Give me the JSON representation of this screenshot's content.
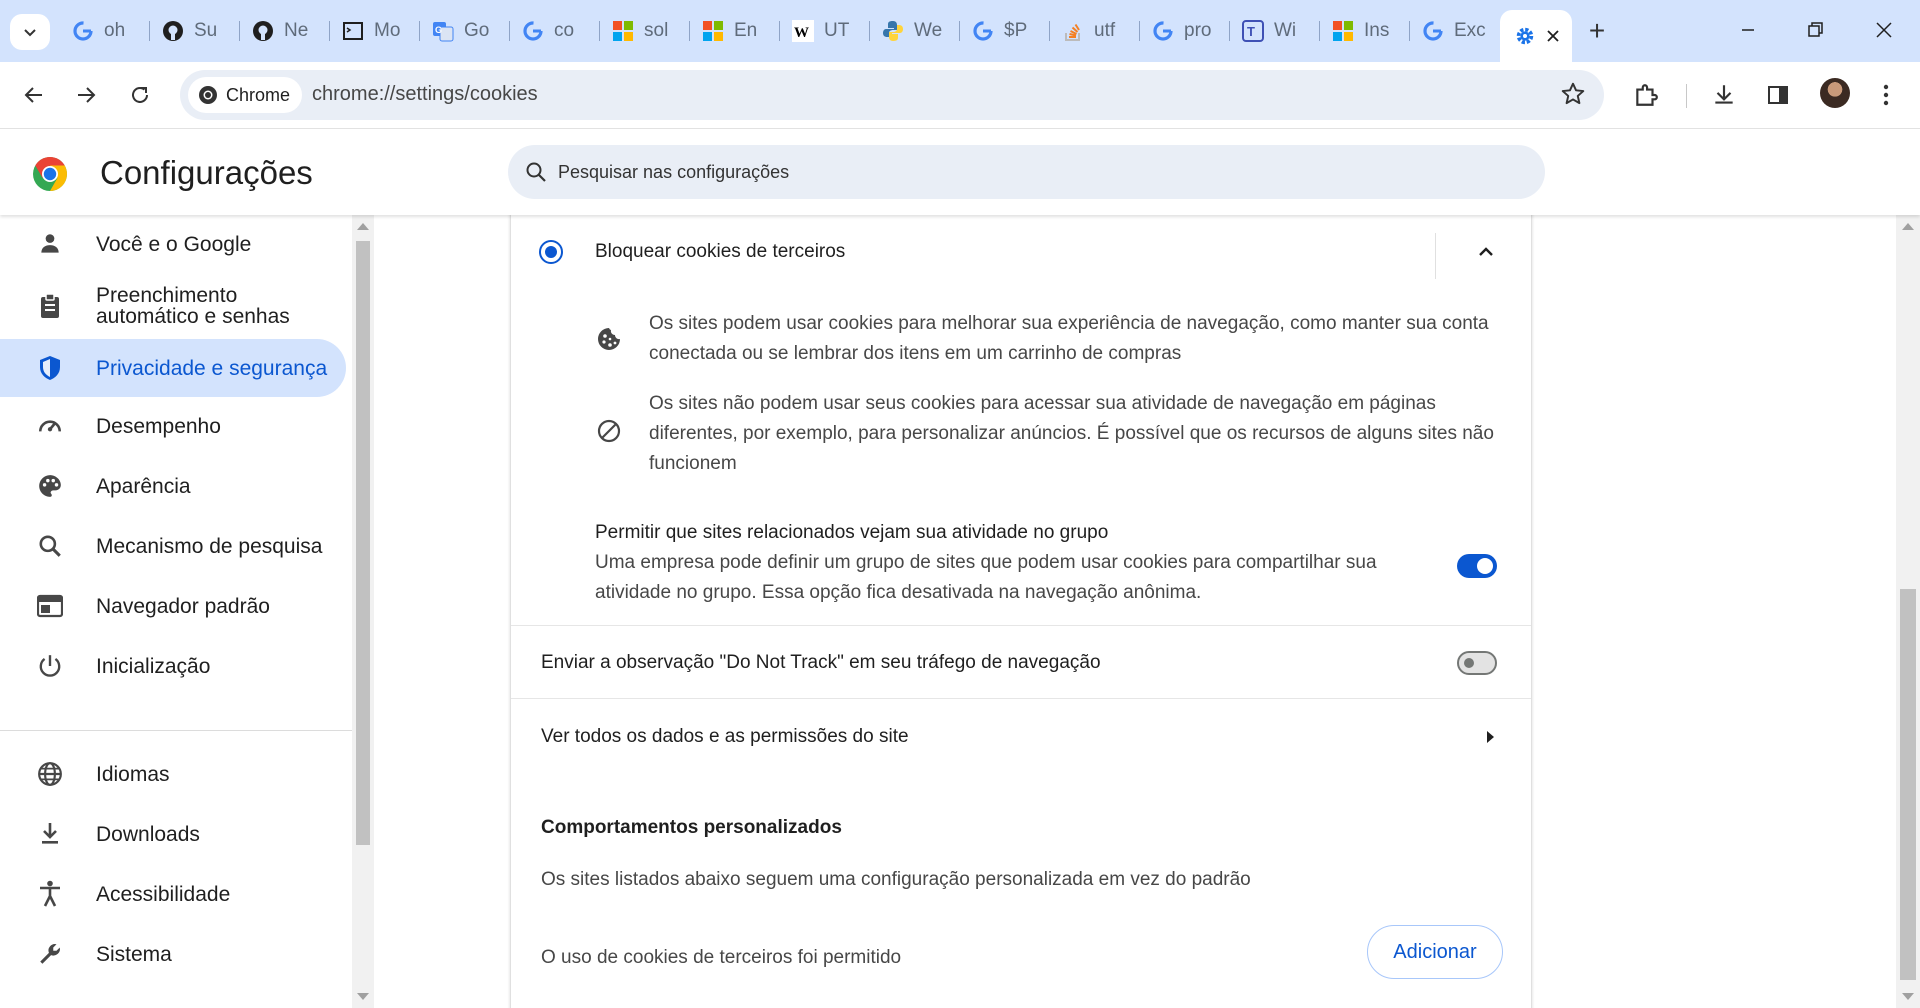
{
  "browser": {
    "tabs": [
      {
        "favicon": "google-icon",
        "title": "oh"
      },
      {
        "favicon": "github-icon",
        "title": "Su"
      },
      {
        "favicon": "github-icon",
        "title": "Ne"
      },
      {
        "favicon": "terminal-icon",
        "title": "Mo"
      },
      {
        "favicon": "google-translate-icon",
        "title": "Go"
      },
      {
        "favicon": "google-icon",
        "title": "co"
      },
      {
        "favicon": "microsoft-icon",
        "title": "sol"
      },
      {
        "favicon": "microsoft-icon",
        "title": "En"
      },
      {
        "favicon": "wikipedia-icon",
        "title": "UT"
      },
      {
        "favicon": "python-icon",
        "title": "We"
      },
      {
        "favicon": "google-icon",
        "title": "$P"
      },
      {
        "favicon": "stackoverflow-icon",
        "title": "utf"
      },
      {
        "favicon": "google-icon",
        "title": "pro"
      },
      {
        "favicon": "translator-icon",
        "title": "Wi"
      },
      {
        "favicon": "microsoft-icon",
        "title": "Ins"
      },
      {
        "favicon": "google-icon",
        "title": "Exc"
      }
    ],
    "active_tab": {
      "favicon": "settings-gear-icon",
      "title": ""
    },
    "new_tab_label": "+",
    "chip_label": "Chrome",
    "url": "chrome://settings/cookies"
  },
  "settings": {
    "title": "Configurações",
    "search_placeholder": "Pesquisar nas configurações",
    "sidebar": [
      {
        "label": "Você e o Google",
        "icon": "person-icon",
        "name": "voce-e-o-google"
      },
      {
        "label": "Preenchimento automático e senhas",
        "icon": "clipboard-icon",
        "name": "preenchimento"
      },
      {
        "label": "Privacidade e segurança",
        "icon": "shield-icon",
        "name": "privacidade",
        "active": true
      },
      {
        "label": "Desempenho",
        "icon": "speedometer-icon",
        "name": "desempenho"
      },
      {
        "label": "Aparência",
        "icon": "palette-icon",
        "name": "aparencia"
      },
      {
        "label": "Mecanismo de pesquisa",
        "icon": "search-icon",
        "name": "mecanismo"
      },
      {
        "label": "Navegador padrão",
        "icon": "browser-window-icon",
        "name": "navegador-padrao"
      },
      {
        "label": "Inicialização",
        "icon": "power-icon",
        "name": "inicializacao"
      },
      {
        "label": "Idiomas",
        "icon": "globe-icon",
        "name": "idiomas"
      },
      {
        "label": "Downloads",
        "icon": "download-icon",
        "name": "downloads"
      },
      {
        "label": "Acessibilidade",
        "icon": "accessibility-icon",
        "name": "acessibilidade"
      },
      {
        "label": "Sistema",
        "icon": "wrench-icon",
        "name": "sistema"
      }
    ],
    "main": {
      "block_option_label": "Bloquear cookies de terceiros",
      "info1": "Os sites podem usar cookies para melhorar sua experiência de navegação, como manter sua conta conectada ou se lembrar dos itens em um carrinho de compras",
      "info2": "Os sites não podem usar seus cookies para acessar sua atividade de navegação em páginas diferentes, por exemplo, para personalizar anúncios. É possível que os recursos de alguns sites não funcionem",
      "related_title": "Permitir que sites relacionados vejam sua atividade no grupo",
      "related_desc": "Uma empresa pode definir um grupo de sites que podem usar cookies para compartilhar sua atividade no grupo. Essa opção fica desativada na navegação anônima.",
      "related_enabled": true,
      "dnt_label": "Enviar a observação \"Do Not Track\" em seu tráfego de navegação",
      "dnt_enabled": false,
      "site_data_label": "Ver todos os dados e as permissões do site",
      "custom_title": "Comportamentos personalizados",
      "custom_desc": "Os sites listados abaixo seguem uma configuração personalizada em vez do padrão",
      "allowed_label": "O uso de cookies de terceiros foi permitido",
      "add_button": "Adicionar"
    }
  },
  "colors": {
    "accent": "#0b57d0",
    "tabstrip": "#d3e3fd",
    "active_nav": "#d3e3fd"
  }
}
